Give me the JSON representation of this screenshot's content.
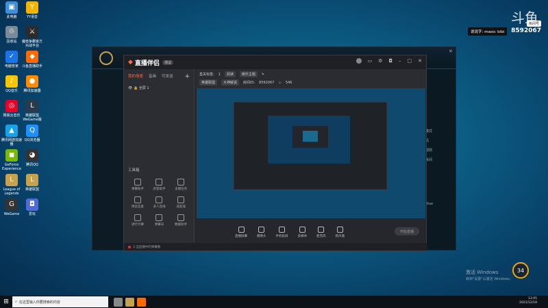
{
  "overlay": {
    "logo": "斗鱼",
    "room_label": "房间号",
    "room_number": "8592067",
    "info_label": "说说字:",
    "info_text": "maoo: bibi"
  },
  "desktop_icons": [
    {
      "label": "此电脑",
      "color": "#3c8fd8",
      "glyph": "▣"
    },
    {
      "label": "YY语音",
      "color": "#f4b400",
      "glyph": "Y"
    },
    {
      "label": "回收站",
      "color": "#7a8a99",
      "glyph": "♲"
    },
    {
      "label": "魔兽争霸官方对战平台",
      "color": "#2b2b2b",
      "glyph": "⚔"
    },
    {
      "label": "电脑管家",
      "color": "#1a73e8",
      "glyph": "✓"
    },
    {
      "label": "斗鱼直播助手",
      "color": "#ff6a00",
      "glyph": "◆"
    },
    {
      "label": "QQ音乐",
      "color": "#f7c600",
      "glyph": "♪"
    },
    {
      "label": "腾讯加速器",
      "color": "#ff8a00",
      "glyph": "●"
    },
    {
      "label": "网易云音乐",
      "color": "#e60026",
      "glyph": "◎"
    },
    {
      "label": "英雄联盟 WeGame版",
      "color": "#2a3a4a",
      "glyph": "L"
    },
    {
      "label": "腾讯网游加速器",
      "color": "#17a2e8",
      "glyph": "▲"
    },
    {
      "label": "QQ浏览器",
      "color": "#1e90ff",
      "glyph": "Q"
    },
    {
      "label": "GeForce Experience",
      "color": "#76b900",
      "glyph": "◼"
    },
    {
      "label": "腾讯QQ",
      "color": "#333",
      "glyph": "◕"
    },
    {
      "label": "League of Legends",
      "color": "#c8a24b",
      "glyph": "L"
    },
    {
      "label": "英雄联盟",
      "color": "#c8a24b",
      "glyph": "L"
    },
    {
      "label": "WeGame",
      "color": "#333",
      "glyph": "G"
    },
    {
      "label": "爱玩",
      "color": "#4f6bd8",
      "glyph": "◘"
    }
  ],
  "app": {
    "title": "直播伴侣",
    "version": "测试",
    "tabs": [
      "我的场景",
      "音画",
      "可发送"
    ],
    "scene_name": "全屏 1",
    "tools_title": "工具箱",
    "tools": [
      {
        "label": "弹幕助手"
      },
      {
        "label": "房管助手"
      },
      {
        "label": "主播任务"
      },
      {
        "label": "预览连麦"
      },
      {
        "label": "多人连线"
      },
      {
        "label": "成就墙"
      },
      {
        "label": "进行大赛"
      },
      {
        "label": "弹幕号"
      },
      {
        "label": "数据助手"
      }
    ],
    "info": {
      "category_label": "直关标签:",
      "category_count": "1",
      "tag1": "阅读",
      "tag2": "娱乐主题",
      "room_tag1": "英雄联盟",
      "room_tag2": "大神解说",
      "room_id_label": "房间ID:",
      "room_id": "8592067",
      "heat": "546"
    },
    "controls": [
      "直播屏幕",
      "摄像头",
      "手机投屏",
      "多媒体",
      "麦克风",
      "扬声器"
    ],
    "start_label": "开始直播",
    "status_text": "3.当直播中的弹幕数"
  },
  "windows": {
    "activate_title": "激活 Windows",
    "activate_sub": "转到\"设置\"以激活 Windows。",
    "gauge_value": "34"
  },
  "taskbar": {
    "search_placeholder": "在这里输入你要搜索的内容",
    "time": "13:05",
    "date": "2021/12/18"
  },
  "game_client": {
    "side_labels": [
      "模式",
      "机",
      "规则",
      "房间"
    ],
    "chat_label": "Blue"
  }
}
